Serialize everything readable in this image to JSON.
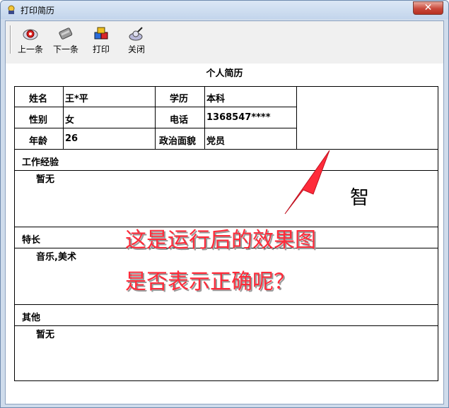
{
  "window": {
    "title": "打印简历"
  },
  "toolbar": {
    "items": [
      {
        "label": "上一条",
        "icon": "prev-record-icon"
      },
      {
        "label": "下一条",
        "icon": "next-record-icon"
      },
      {
        "label": "打印",
        "icon": "print-icon"
      },
      {
        "label": "关闭",
        "icon": "close-form-icon"
      }
    ]
  },
  "resume": {
    "title": "个人简历",
    "fields": {
      "name_label": "姓名",
      "name_value": "王*平",
      "edu_label": "学历",
      "edu_value": "本科",
      "gender_label": "性别",
      "gender_value": "女",
      "phone_label": "电话",
      "phone_value": "1368547****",
      "age_label": "年龄",
      "age_value": "26",
      "political_label": "政治面貌",
      "political_value": "党员"
    },
    "photo_text": "智",
    "sections": [
      {
        "heading": "工作经验",
        "content": "暂无"
      },
      {
        "heading": "特长",
        "content": "音乐,美术"
      },
      {
        "heading": "其他",
        "content": "暂无"
      }
    ]
  },
  "annotation": {
    "line1": "这是运行后的效果图",
    "line2": "是否表示正确呢？",
    "color": "#ff2b3a"
  }
}
